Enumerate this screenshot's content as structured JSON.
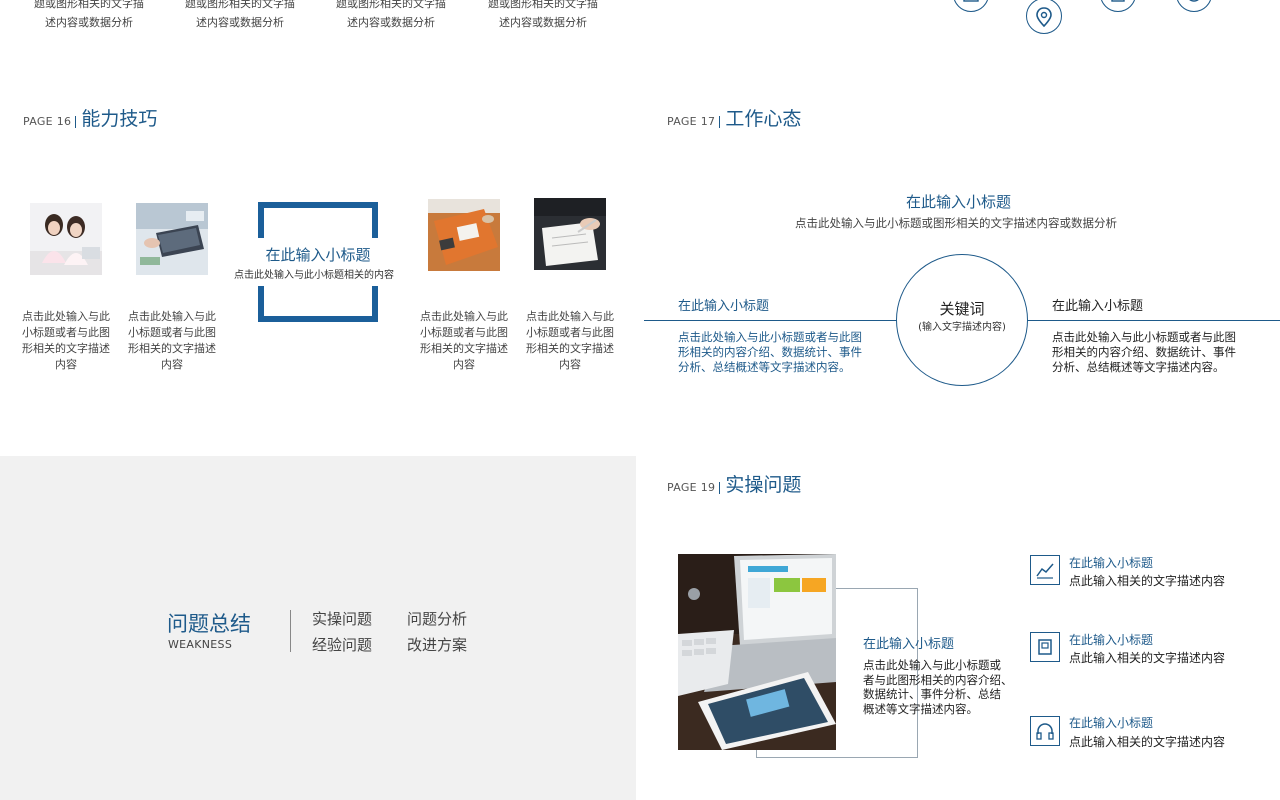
{
  "colors": {
    "accent": "#1e5a8a",
    "frame": "#1b5f9a",
    "grey_panel": "#f1f1f1"
  },
  "top_row": {
    "texts": [
      {
        "line1": "题或图形相关的文字描",
        "line2": "述内容或数据分析"
      },
      {
        "line1": "题或图形相关的文字描",
        "line2": "述内容或数据分析"
      },
      {
        "line1": "题或图形相关的文字描",
        "line2": "述内容或数据分析"
      },
      {
        "line1": "题或图形相关的文字描",
        "line2": "述内容或数据分析"
      }
    ],
    "icons": [
      "calendar-icon",
      "map-pin-icon",
      "book-icon",
      "clock-icon"
    ]
  },
  "page16": {
    "page_num": "PAGE 16",
    "title": "能力技巧",
    "center": {
      "title": "在此输入小标题",
      "desc": "点击此处输入与此小标题相关的内容"
    },
    "captions": [
      {
        "l1": "点击此处输入与此",
        "l2": "小标题或者与此图",
        "l3": "形相关的文字描述",
        "l4": "内容"
      },
      {
        "l1": "点击此处输入与此",
        "l2": "小标题或者与此图",
        "l3": "形相关的文字描述",
        "l4": "内容"
      },
      {
        "l1": "点击此处输入与此",
        "l2": "小标题或者与此图",
        "l3": "形相关的文字描述",
        "l4": "内容"
      },
      {
        "l1": "点击此处输入与此",
        "l2": "小标题或者与此图",
        "l3": "形相关的文字描述",
        "l4": "内容"
      }
    ]
  },
  "page17": {
    "page_num": "PAGE 17",
    "title": "工作心态",
    "top": {
      "title": "在此输入小标题",
      "desc": "点击此处输入与此小标题或图形相关的文字描述内容或数据分析"
    },
    "keyword": {
      "title": "关键词",
      "sub": "(输入文字描述内容)"
    },
    "left": {
      "title": "在此输入小标题",
      "l1": "点击此处输入与此小标题或者与此图",
      "l2": "形相关的内容介绍、数据统计、事件",
      "l3": "分析、总结概述等文字描述内容。"
    },
    "right": {
      "title": "在此输入小标题",
      "l1": "点击此处输入与此小标题或者与此图",
      "l2": "形相关的内容介绍、数据统计、事件",
      "l3": "分析、总结概述等文字描述内容。"
    }
  },
  "summary": {
    "title": "问题总结",
    "subtitle": "WEAKNESS",
    "items": [
      "实操问题",
      "问题分析",
      "经验问题",
      "改进方案"
    ]
  },
  "page19": {
    "page_num": "PAGE 19",
    "title": "实操问题",
    "center": {
      "title": "在此输入小标题",
      "l1": "点击此处输入与此小标题或",
      "l2": "者与此图形相关的内容介绍、",
      "l3": "数据统计、事件分析、总结",
      "l4": "概述等文字描述内容。"
    },
    "items": [
      {
        "icon": "chart-icon",
        "title": "在此输入小标题",
        "desc": "点此输入相关的文字描述内容"
      },
      {
        "icon": "document-icon",
        "title": "在此输入小标题",
        "desc": "点此输入相关的文字描述内容"
      },
      {
        "icon": "headphones-icon",
        "title": "在此输入小标题",
        "desc": "点此输入相关的文字描述内容"
      }
    ]
  }
}
